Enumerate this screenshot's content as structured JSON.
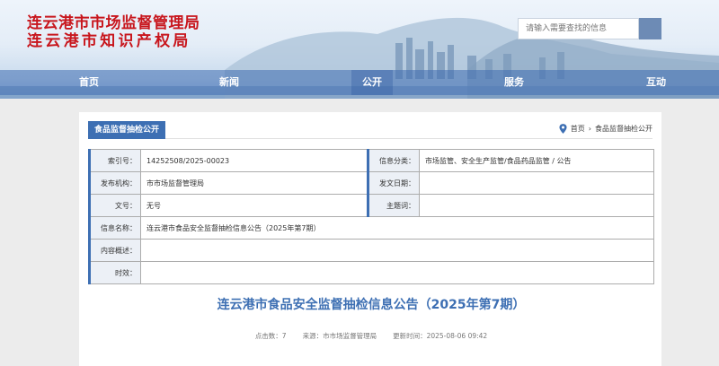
{
  "site": {
    "title_line1": "连云港市市场监督管理局",
    "title_line2": "连云港市知识产权局",
    "brand_color": "#c8161d",
    "accent_color": "#3d6fb3"
  },
  "search": {
    "placeholder": "请输入需要查找的信息",
    "button_icon": "search-icon"
  },
  "nav": {
    "items": [
      "首页",
      "新闻",
      "公开",
      "服务",
      "互动"
    ],
    "active": "公开"
  },
  "section": {
    "tab_label": "食品监督抽检公开"
  },
  "breadcrumb": {
    "icon": "location-pin-icon",
    "home": "首页",
    "separator": "›",
    "current": "食品监督抽检公开"
  },
  "info": {
    "index_label": "索引号：",
    "index_value": "14252508/2025-00023",
    "category_label": "信息分类：",
    "category_value": "市场监管、安全生产监管/食品药品监管 / 公告",
    "publisher_label": "发布机构：",
    "publisher_value": "市市场监督管理局",
    "date_label": "发文日期：",
    "date_value": "",
    "docno_label": "文号：",
    "docno_value": "无号",
    "subject_label": "主题词：",
    "subject_value": "",
    "name_label": "信息名称：",
    "name_value": "连云港市食品安全监督抽检信息公告（2025年第7期）",
    "summary_label": "内容概述：",
    "summary_value": "",
    "effect_label": "时效：",
    "effect_value": ""
  },
  "document": {
    "title": "连云港市食品安全监督抽检信息公告（2025年第7期）",
    "clicks": "点击数：7",
    "source": "来源：市市场监督管理局",
    "updated": "更新时间：2025-08-06 09:42"
  }
}
